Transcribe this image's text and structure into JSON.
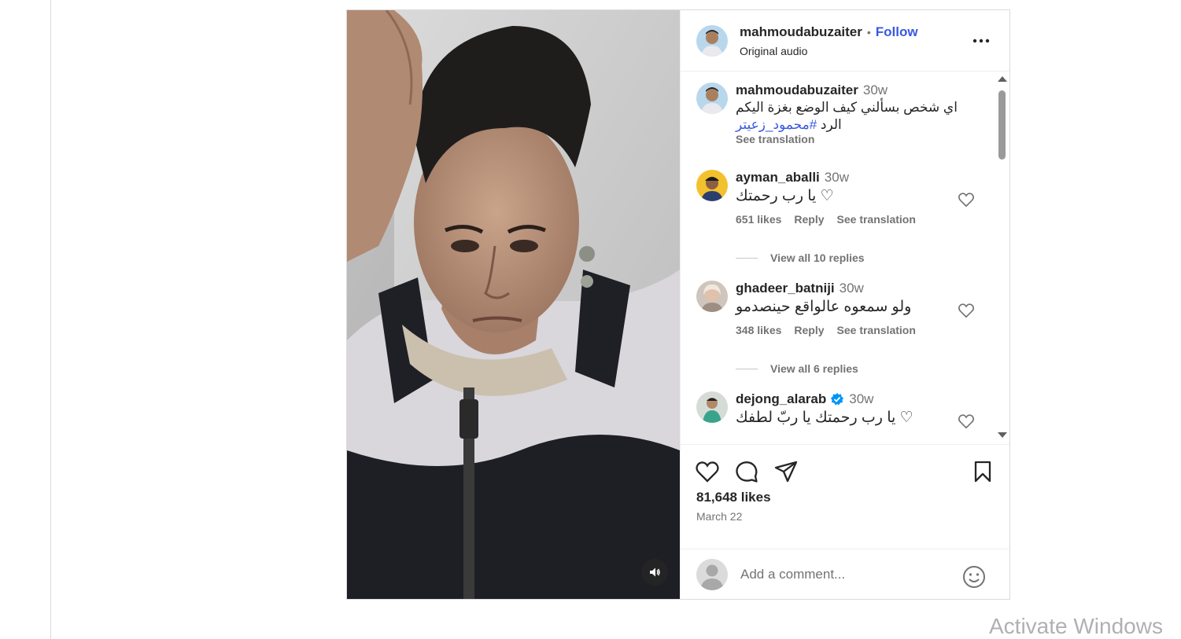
{
  "post": {
    "author": {
      "username": "mahmoudabuzaiter",
      "follow_label": "Follow",
      "audio": "Original audio",
      "separator": "•"
    },
    "caption": {
      "username": "mahmoudabuzaiter",
      "time": "30w",
      "text_line1": "اي شخص بسألني كيف الوضع بغزة اليكم",
      "text_line2_prefix": "الرد ",
      "hashtag": "#محمود_زعيتر",
      "see_translation": "See translation"
    },
    "comments": [
      {
        "username": "ayman_aballi",
        "time": "30w",
        "text": "يا رب رحمتك ♡",
        "likes": "651 likes",
        "reply": "Reply",
        "see_translation": "See translation",
        "view_replies": "View all 10 replies"
      },
      {
        "username": "ghadeer_batniji",
        "time": "30w",
        "text": "ولو سمعوه عالواقع حينصدمو",
        "likes": "348 likes",
        "reply": "Reply",
        "see_translation": "See translation",
        "view_replies": "View all 6 replies"
      },
      {
        "username": "dejong_alarab",
        "time": "30w",
        "verified": true,
        "text": "يا رب رحمتك يا ربّ لطفك ♡"
      }
    ],
    "total_likes": "81,648 likes",
    "date": "March 22",
    "add_comment_placeholder": "Add a comment..."
  },
  "icons": [
    "more-icon",
    "heart-icon",
    "comment-icon",
    "share-icon",
    "bookmark-icon",
    "emoji-icon",
    "volume-icon",
    "verified-icon"
  ],
  "colors": {
    "link_blue": "#3a59e0",
    "verified_blue": "#0095f6",
    "muted_text": "#737373"
  },
  "os_overlay": {
    "watermark": "Activate Windows"
  }
}
